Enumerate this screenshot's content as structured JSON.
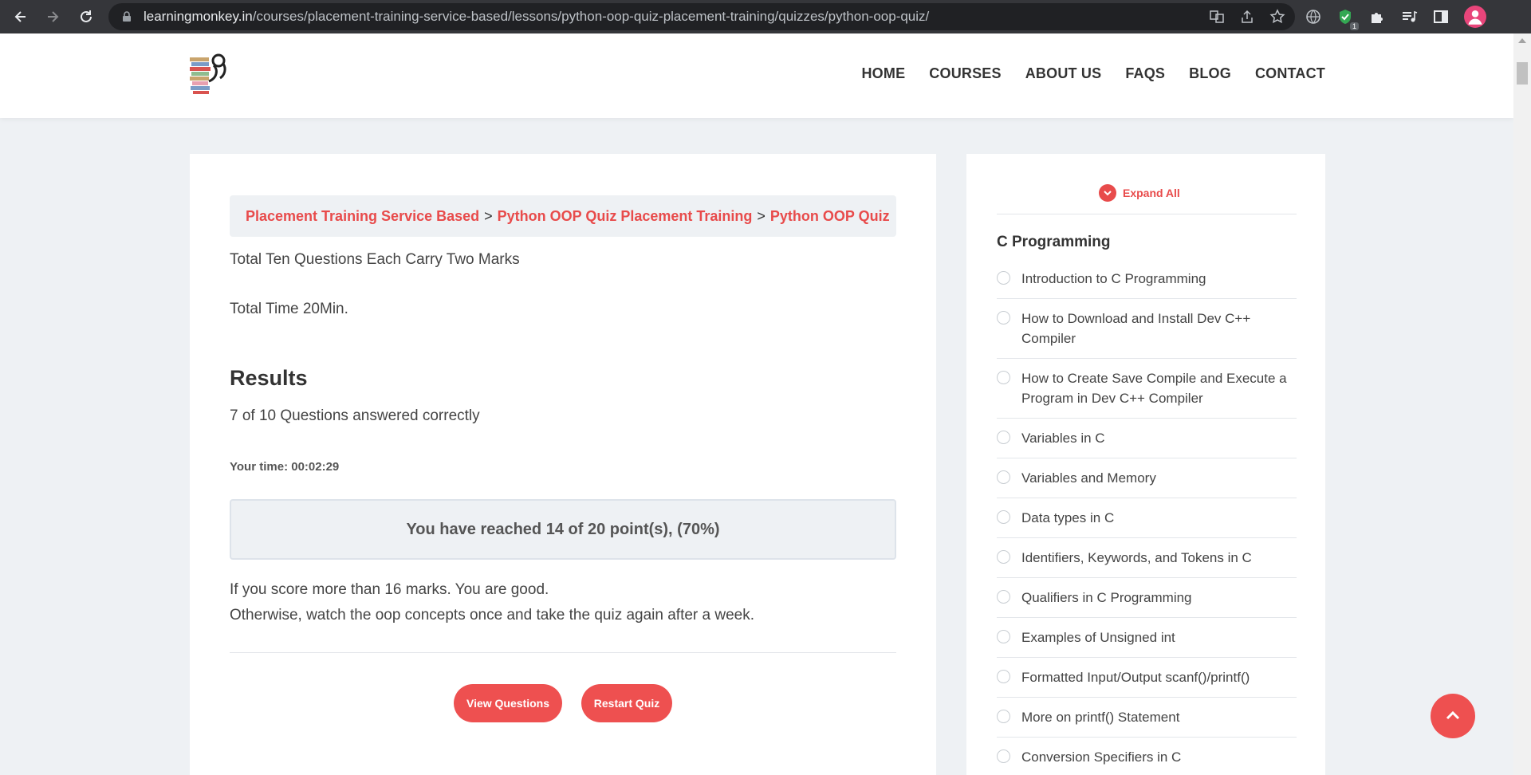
{
  "browser": {
    "url_host": "learningmonkey.in",
    "url_path": "/courses/placement-training-service-based/lessons/python-oop-quiz-placement-training/quizzes/python-oop-quiz/",
    "extension_badge": "1"
  },
  "nav": {
    "items": [
      {
        "label": "HOME"
      },
      {
        "label": "COURSES"
      },
      {
        "label": "ABOUT US"
      },
      {
        "label": "FAQS"
      },
      {
        "label": "BLOG"
      },
      {
        "label": "CONTACT"
      }
    ]
  },
  "breadcrumb": {
    "items": [
      {
        "label": "Placement Training Service Based"
      },
      {
        "label": "Python OOP Quiz Placement Training"
      },
      {
        "label": "Python OOP Quiz"
      }
    ],
    "separator": ">"
  },
  "quiz": {
    "intro_questions": "Total Ten Questions Each Carry Two Marks",
    "intro_time": "Total Time 20Min.",
    "results_title": "Results",
    "answered": "7 of 10 Questions answered correctly",
    "your_time": "Your time: 00:02:29",
    "score": "You have reached 14 of 20 point(s), (70%)",
    "advice_1": "If you score more than 16 marks. You are good.",
    "advice_2": "Otherwise, watch the oop concepts once and take the quiz again after a week.",
    "view_questions_label": "View Questions",
    "restart_label": "Restart Quiz"
  },
  "sidebar": {
    "expand_all_label": "Expand All",
    "section_title": "C Programming",
    "lessons": [
      {
        "title": "Introduction to C Programming"
      },
      {
        "title": "How to Download and Install Dev C++ Compiler"
      },
      {
        "title": "How to Create Save Compile and Execute a Program in Dev C++ Compiler"
      },
      {
        "title": "Variables in C"
      },
      {
        "title": "Variables and Memory"
      },
      {
        "title": "Data types in C"
      },
      {
        "title": "Identifiers, Keywords, and Tokens in C"
      },
      {
        "title": "Qualifiers in C Programming"
      },
      {
        "title": "Examples of Unsigned int"
      },
      {
        "title": "Formatted Input/Output scanf()/printf()"
      },
      {
        "title": "More on printf() Statement"
      },
      {
        "title": "Conversion Specifiers in C"
      }
    ]
  },
  "colors": {
    "accent": "#ee5050",
    "link": "#e84b4b",
    "page_bg": "#eef1f4"
  }
}
